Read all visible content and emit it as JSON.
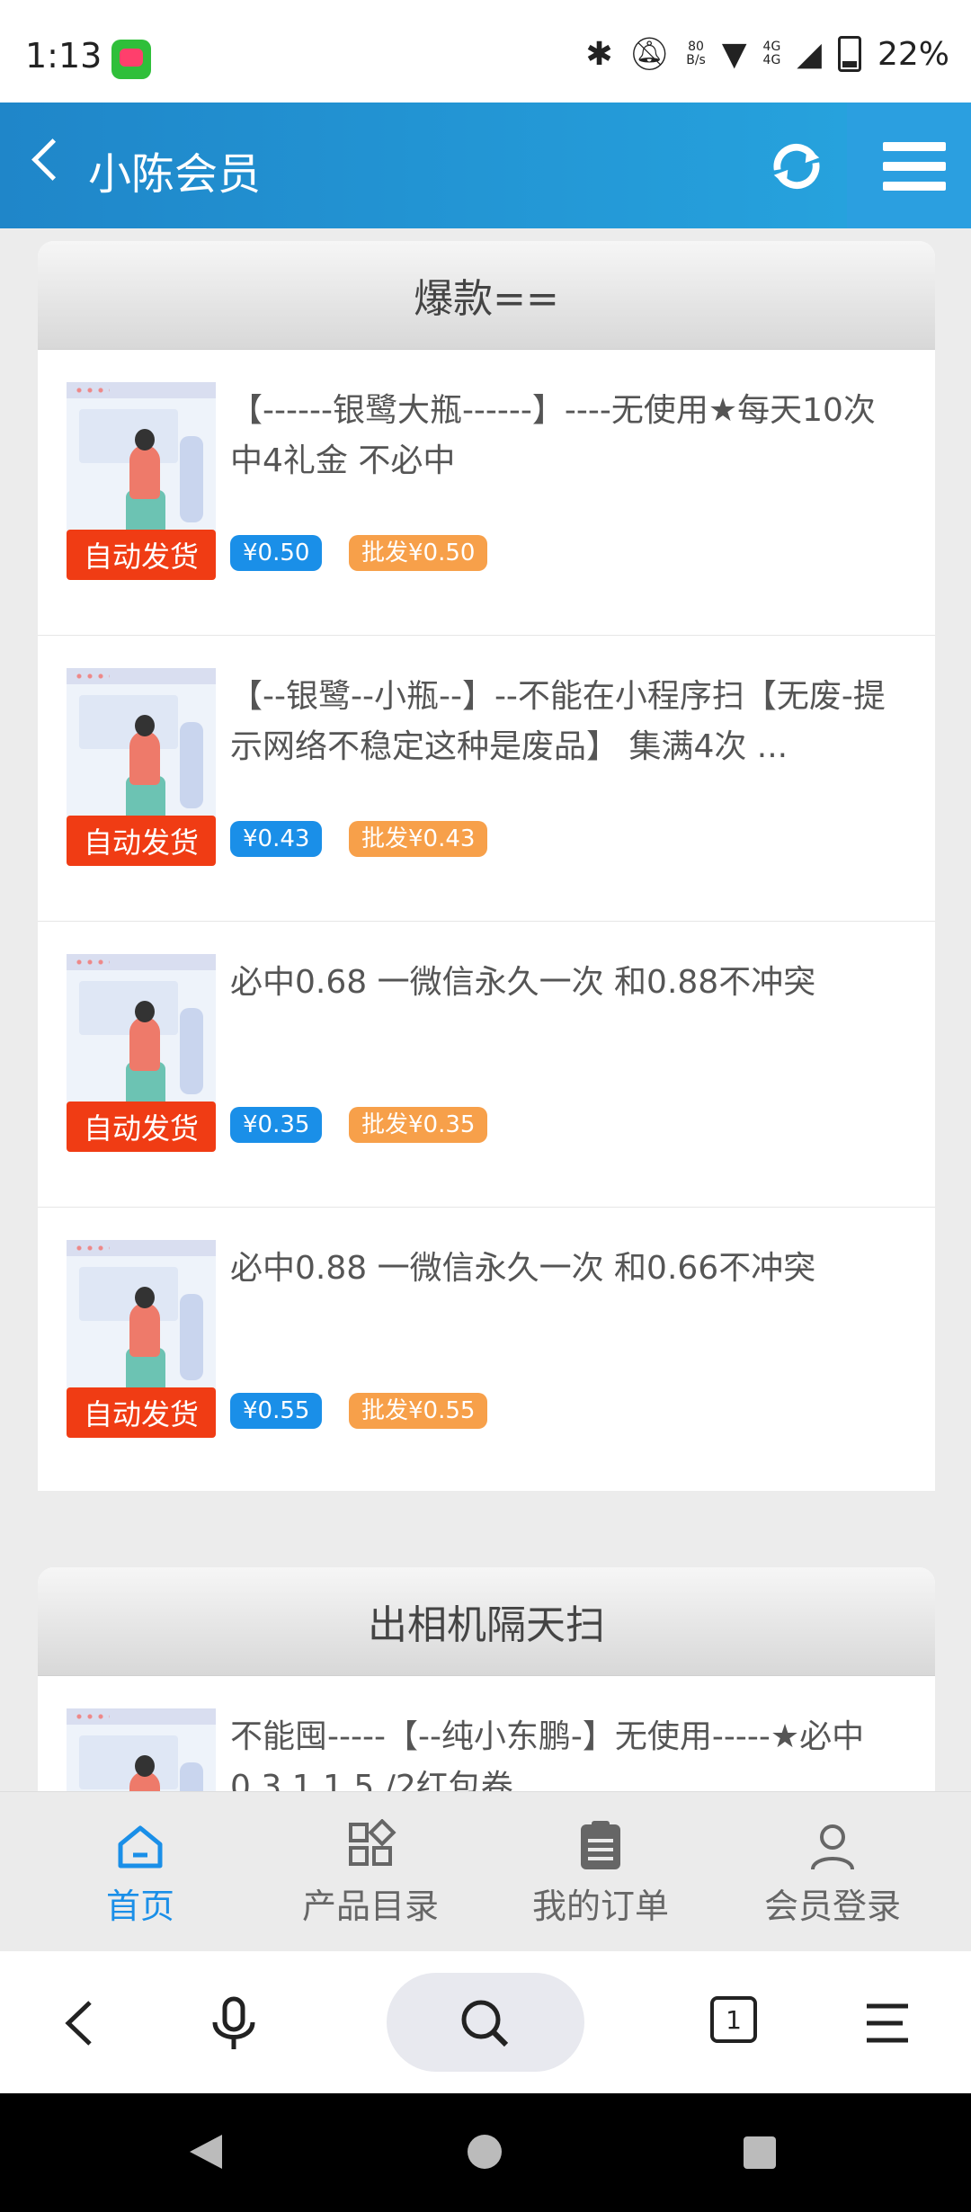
{
  "status_bar": {
    "time": "1:13",
    "net_speed_top": "80",
    "net_speed_bottom": "B/s",
    "network": "4G",
    "battery": "22%"
  },
  "header": {
    "title": "小陈会员",
    "accent": "#1f86c9"
  },
  "sections": [
    {
      "title": "爆款==",
      "items": [
        {
          "title": "【------银鹭大瓶------】----无使用★每天10次中4礼金 不必中",
          "tag": "自动发货",
          "price": "¥0.50",
          "wholesale": "批发¥0.50"
        },
        {
          "title": "【--银鹭--小瓶--】--不能在小程序扫【无废-提示网络不稳定这种是废品】 集满4次 ...",
          "tag": "自动发货",
          "price": "¥0.43",
          "wholesale": "批发¥0.43"
        },
        {
          "title": "必中0.68 一微信永久一次 和0.88不冲突",
          "tag": "自动发货",
          "price": "¥0.35",
          "wholesale": "批发¥0.35"
        },
        {
          "title": "必中0.88 一微信永久一次 和0.66不冲突",
          "tag": "自动发货",
          "price": "¥0.55",
          "wholesale": "批发¥0.55"
        }
      ]
    },
    {
      "title": "出相机隔天扫",
      "items": [
        {
          "title": "不能囤-----【--纯小东鹏-】无使用-----★必中0.3.1.1.5./2红包卷"
        }
      ]
    }
  ],
  "bottom_nav": [
    {
      "label": "首页",
      "icon": "home-icon",
      "active": true
    },
    {
      "label": "产品目录",
      "icon": "grid-icon",
      "active": false
    },
    {
      "label": "我的订单",
      "icon": "clipboard-icon",
      "active": false
    },
    {
      "label": "会员登录",
      "icon": "user-icon",
      "active": false
    }
  ],
  "browser_toolbar": {
    "tabs_count": "1"
  },
  "colors": {
    "auto_tag": "#f03c14",
    "price": "#1a8fe8",
    "wholesale": "#f7a04a",
    "nav_active": "#1a8fe8"
  }
}
